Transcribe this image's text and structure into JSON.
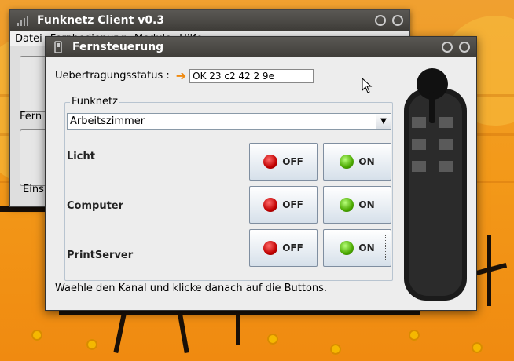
{
  "back_window": {
    "title": "Funknetz Client v0.3",
    "menu": [
      "Datei",
      "Fernbedienung",
      "Module",
      "Hilfe"
    ],
    "labels": [
      "Fern",
      "Eins"
    ]
  },
  "dialog": {
    "title": "Fernsteuerung",
    "status_label": "Uebertragungsstatus :",
    "status_value": "OK 23 c2 42 2 9e",
    "group_title": "Funknetz",
    "network_selected": "Arbeitszimmer",
    "rows": [
      {
        "label": "Licht",
        "off": "OFF",
        "on": "ON"
      },
      {
        "label": "Computer",
        "off": "OFF",
        "on": "ON"
      },
      {
        "label": "PrintServer",
        "off": "OFF",
        "on": "ON"
      }
    ],
    "hint": "Waehle den Kanal und klicke danach auf die Buttons."
  },
  "colors": {
    "accent": "#f08a10",
    "titlebar": "#3f3d39",
    "on": "#4aa800",
    "off": "#c00000"
  }
}
